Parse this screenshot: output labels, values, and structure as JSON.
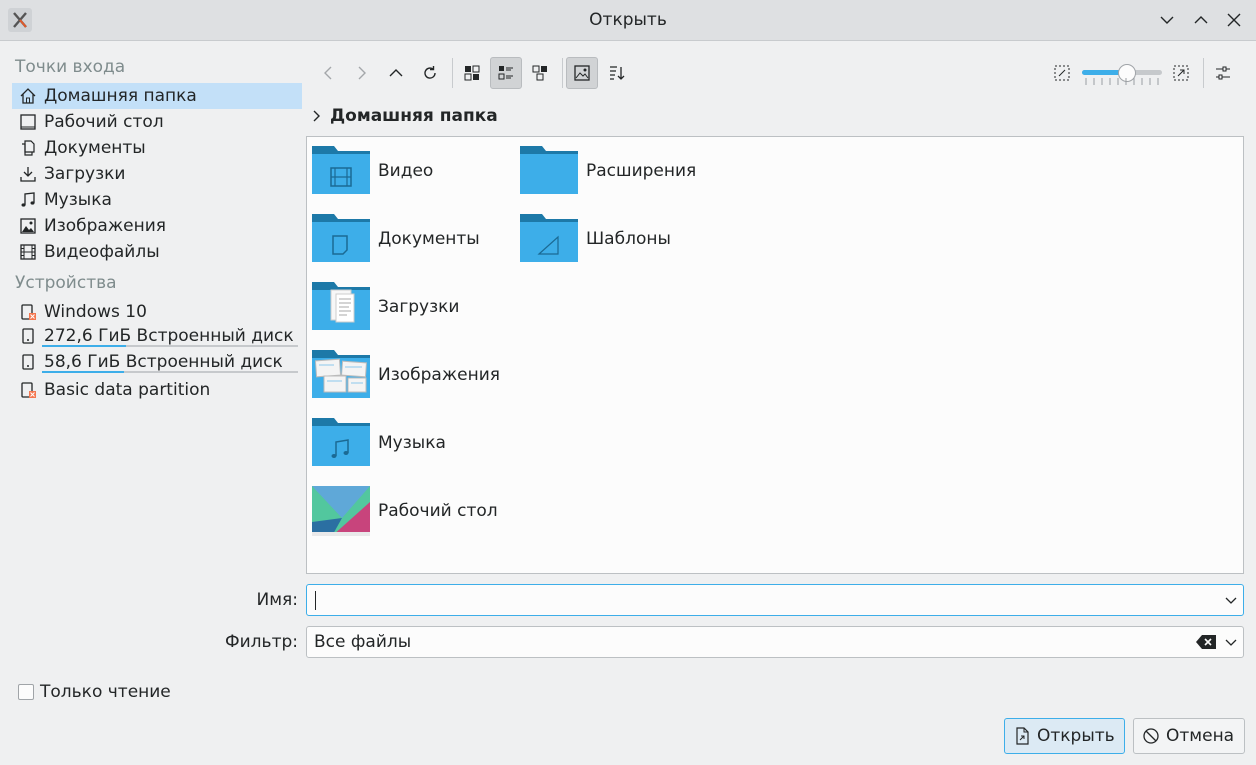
{
  "window": {
    "title": "Открыть"
  },
  "sidebar": {
    "places_title": "Точки входа",
    "places": [
      {
        "label": "Домашняя папка",
        "icon": "home-icon",
        "active": true
      },
      {
        "label": "Рабочий стол",
        "icon": "desktop-icon"
      },
      {
        "label": "Документы",
        "icon": "documents-icon"
      },
      {
        "label": "Загрузки",
        "icon": "download-icon"
      },
      {
        "label": "Музыка",
        "icon": "music-icon"
      },
      {
        "label": "Изображения",
        "icon": "image-icon"
      },
      {
        "label": "Видеофайлы",
        "icon": "video-icon"
      }
    ],
    "devices_title": "Устройства",
    "devices": [
      {
        "label": "Windows 10",
        "icon": "drive-unmounted-icon"
      },
      {
        "label": "272,6 ГиБ Встроенный диск",
        "icon": "drive-icon",
        "usage_fraction": 0.33
      },
      {
        "label": "58,6 ГиБ Встроенный диск",
        "icon": "drive-icon",
        "usage_fraction": 0.32
      },
      {
        "label": "Basic data partition",
        "icon": "drive-unmounted-icon"
      }
    ]
  },
  "toolbar": {
    "zoom_fraction": 0.55
  },
  "breadcrumb": {
    "label": "Домашняя папка"
  },
  "files": [
    {
      "label": "Видео",
      "icon": "folder-video-icon"
    },
    {
      "label": "Расширения",
      "icon": "folder-icon"
    },
    {
      "label": "Документы",
      "icon": "folder-documents-icon"
    },
    {
      "label": "Шаблоны",
      "icon": "folder-templates-icon"
    },
    {
      "label": "Загрузки",
      "icon": "folder-downloads-icon"
    },
    {
      "label": "Изображения",
      "icon": "folder-pictures-icon"
    },
    {
      "label": "Музыка",
      "icon": "folder-music-icon"
    },
    {
      "label": "Рабочий стол",
      "icon": "folder-desktop-icon"
    }
  ],
  "form": {
    "name_label": "Имя:",
    "name_value": "",
    "filter_label": "Фильтр:",
    "filter_value": "Все файлы",
    "readonly_label": "Только чтение"
  },
  "buttons": {
    "open": "Открыть",
    "cancel": "Отмена"
  },
  "colors": {
    "accent": "#3daee9",
    "folder": "#3daee9",
    "folder_dark": "#1d99d3"
  }
}
